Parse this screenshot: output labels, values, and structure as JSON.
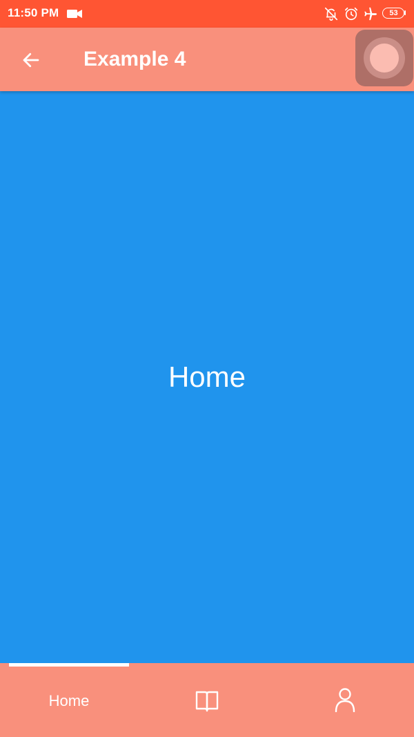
{
  "status_bar": {
    "time": "11:50 PM",
    "battery": "53",
    "icons": [
      "video-camera-icon",
      "notifications-off-icon",
      "alarm-icon",
      "airplane-icon",
      "battery-icon"
    ]
  },
  "app_bar": {
    "title": "Example 4",
    "back_icon": "arrow-back-icon"
  },
  "main": {
    "label": "Home"
  },
  "bottom_nav": {
    "tabs": [
      {
        "label": "Home",
        "selected": true
      },
      {
        "icon": "book-open-icon",
        "selected": false
      },
      {
        "icon": "person-icon",
        "selected": false
      }
    ]
  },
  "colors": {
    "status_bar": "#ff5533",
    "app_bar": "#f9907c",
    "content": "#2094ed",
    "text": "#ffffff"
  }
}
